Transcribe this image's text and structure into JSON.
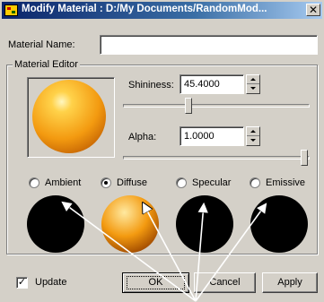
{
  "window": {
    "title": "Modify Material : D:/My Documents/RandomMod...",
    "close_glyph": "✕"
  },
  "material_name": {
    "label": "Material Name:",
    "value": ""
  },
  "material_editor": {
    "title": "Material Editor",
    "shininess": {
      "label": "Shininess:",
      "value": "45.4000",
      "slider_fraction": 0.35
    },
    "alpha": {
      "label": "Alpha:",
      "value": "1.0000",
      "slider_fraction": 1.0
    },
    "components": [
      {
        "label": "Ambient",
        "checked": false,
        "color": "#000000"
      },
      {
        "label": "Diffuse",
        "checked": true,
        "color": "#f39a10"
      },
      {
        "label": "Specular",
        "checked": false,
        "color": "#000000"
      },
      {
        "label": "Emissive",
        "checked": false,
        "color": "#000000"
      }
    ]
  },
  "footer": {
    "update_label": "Update",
    "update_checked": true,
    "check_glyph": "✓",
    "ok_label": "OK",
    "cancel_label": "Cancel",
    "apply_label": "Apply"
  },
  "colors": {
    "preview_sphere": "#f39a10",
    "title_bar": "#0a246a"
  }
}
